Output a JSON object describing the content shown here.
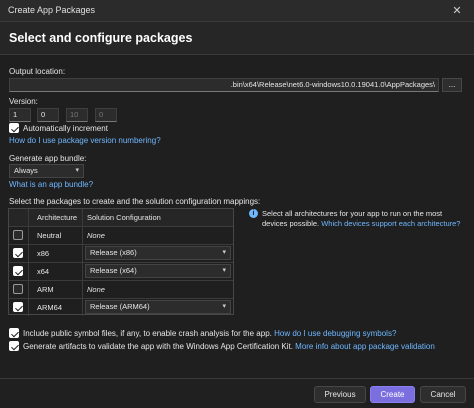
{
  "window": {
    "title": "Create App Packages",
    "close_glyph": "✕"
  },
  "header": {
    "title": "Select and configure packages"
  },
  "output": {
    "label": "Output location:",
    "value": ".bin\\x64\\Release\\net6.0-windows10.0.19041.0\\AppPackages\\",
    "browse_label": "..."
  },
  "version": {
    "label": "Version:",
    "major": "1",
    "minor": "0",
    "build": "10",
    "revision": "0",
    "auto_increment_label": "Automatically increment",
    "auto_increment_checked": true,
    "help_link": "How do I use package version numbering?"
  },
  "bundle": {
    "label": "Generate app bundle:",
    "selected": "Always",
    "help_link": "What is an app bundle?"
  },
  "packages": {
    "intro": "Select the packages to create and the solution configuration mappings:",
    "col_architecture": "Architecture",
    "col_configuration": "Solution Configuration",
    "rows": [
      {
        "arch": "Neutral",
        "checked": false,
        "config": "None",
        "dropdown": false
      },
      {
        "arch": "x86",
        "checked": true,
        "config": "Release (x86)",
        "dropdown": true
      },
      {
        "arch": "x64",
        "checked": true,
        "config": "Release (x64)",
        "dropdown": true
      },
      {
        "arch": "ARM",
        "checked": false,
        "config": "None",
        "dropdown": false
      },
      {
        "arch": "ARM64",
        "checked": true,
        "config": "Release (ARM64)",
        "dropdown": true
      }
    ]
  },
  "info": {
    "text": "Select all architectures for your app to run on the most devices possible.",
    "link": "Which devices support each architecture?"
  },
  "options": {
    "symbols_label": "Include public symbol files, if any, to enable crash analysis for the app.",
    "symbols_link": "How do I use debugging symbols?",
    "symbols_checked": true,
    "artifacts_label": "Generate artifacts to validate the app with the Windows App Certification Kit.",
    "artifacts_link": "More info about app package validation",
    "artifacts_checked": true
  },
  "buttons": {
    "previous": "Previous",
    "create": "Create",
    "cancel": "Cancel"
  }
}
